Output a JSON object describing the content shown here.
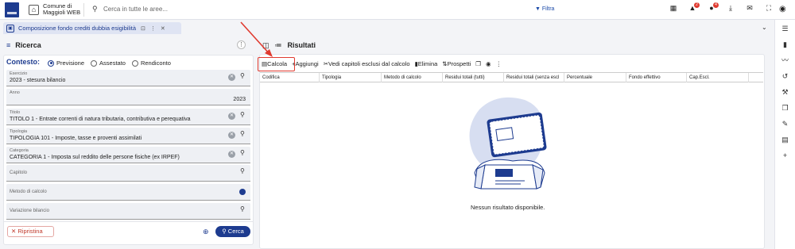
{
  "app": {
    "name_line1": "Comune di",
    "name_line2": "Maggioli WEB"
  },
  "search": {
    "placeholder": "Cerca in tutte le aree...",
    "filter_label": "Filtra"
  },
  "topbar_badges": {
    "alerts": "2",
    "notifications": "4"
  },
  "tab": {
    "title": "Composizione fondo crediti dubbia esigibilità"
  },
  "left": {
    "title": "Ricerca",
    "context_label": "Contesto:",
    "radios": [
      "Previsione",
      "Assestato",
      "Rendiconto"
    ],
    "selected_radio": "Previsione",
    "fields": [
      {
        "label": "Esercizio",
        "value": "2023 - stesura bilancio"
      },
      {
        "label": "Anno",
        "value": "2023"
      },
      {
        "label": "Titolo",
        "value": "TITOLO 1 - Entrate correnti di natura tributaria, contributiva e perequativa"
      },
      {
        "label": "Tipologia",
        "value": "TIPOLOGIA 101 - Imposte, tasse e proventi assimilati"
      },
      {
        "label": "Categoria",
        "value": "CATEGORIA 1 - Imposta sul reddito delle persone fisiche (ex IRPEF)"
      },
      {
        "label": "Capitolo",
        "value": ""
      },
      {
        "label": "Metodo di calcolo",
        "value": ""
      },
      {
        "label": "Variazione bilancio",
        "value": ""
      }
    ],
    "reset_label": "Ripristina",
    "search_label": "Cerca"
  },
  "right": {
    "title": "Risultati",
    "toolbar": [
      "Calcola",
      "Aggiungi",
      "Vedi capitoli esclusi dal calcolo",
      "Elimina",
      "Prospetti"
    ],
    "columns": [
      "Codifica",
      "Tipologia",
      "Metodo di calcolo",
      "Residui totali (tutti)",
      "Residui totali (senza escl",
      "Percentuale",
      "Fondo effettivo",
      "Cap.Escl."
    ],
    "empty_message": "Nessun risultato disponibile."
  },
  "colors": {
    "brand": "#1d3b8f",
    "danger": "#e03a2f"
  }
}
